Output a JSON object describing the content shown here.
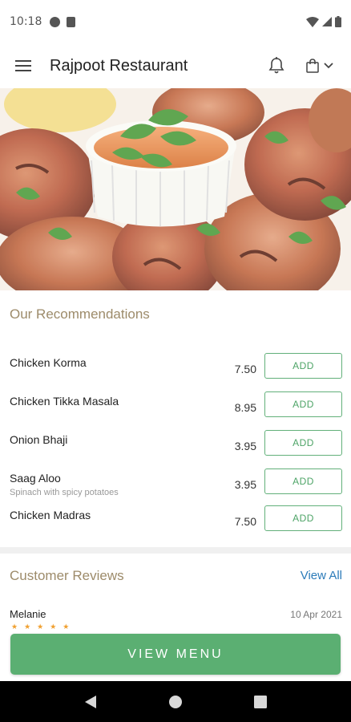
{
  "status_bar": {
    "time": "10:18",
    "icons": [
      "app-notification-icon",
      "sim-card-icon",
      "wifi-icon",
      "cell-signal-icon",
      "battery-icon"
    ]
  },
  "app_bar": {
    "title": "Rajpoot Restaurant",
    "icons": [
      "menu-icon",
      "bell-icon",
      "shopping-bag-icon",
      "chevron-down-icon"
    ]
  },
  "hero": {
    "description_icon": "food-photo"
  },
  "recommendations": {
    "title": "Our Recommendations",
    "add_label": "ADD",
    "items": [
      {
        "name": "Chicken Korma",
        "description": "",
        "price": "7.50"
      },
      {
        "name": "Chicken Tikka Masala",
        "description": "",
        "price": "8.95"
      },
      {
        "name": "Onion Bhaji",
        "description": "",
        "price": "3.95"
      },
      {
        "name": "Saag Aloo",
        "description": "Spinach with spicy potatoes",
        "price": "3.95"
      },
      {
        "name": "Chicken Madras",
        "description": "",
        "price": "7.50"
      }
    ]
  },
  "reviews": {
    "title": "Customer Reviews",
    "view_all": "View All",
    "first_review": {
      "name": "Melanie",
      "date": "10 Apr 2021",
      "stars": "★★★★★"
    }
  },
  "cta": {
    "label": "VIEW MENU"
  },
  "colors": {
    "accent_green": "#5baf72",
    "section_title": "#9d8b6a",
    "link_blue": "#2b7bb9"
  },
  "nav_bar": {
    "icons": [
      "back-icon",
      "home-icon",
      "recents-icon"
    ]
  }
}
